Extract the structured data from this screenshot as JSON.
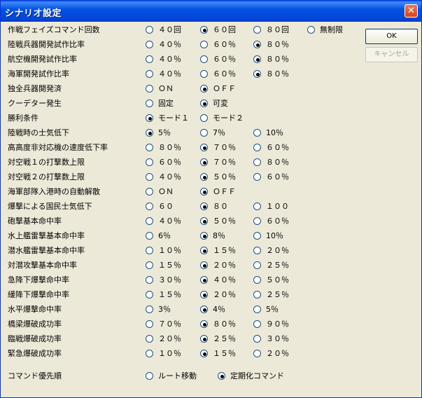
{
  "window": {
    "title": "シナリオ設定"
  },
  "buttons": {
    "ok": "OK",
    "cancel": "キャンセル"
  },
  "rows": [
    {
      "label": "作戦フェイズコマンド回数",
      "options": [
        "４０回",
        "６０回",
        "８０回",
        "無制限"
      ],
      "selected": 1
    },
    {
      "label": "陸戦兵器開発試作比率",
      "options": [
        "４０％",
        "６０％",
        "８０％"
      ],
      "selected": 2
    },
    {
      "label": "航空機開発試作比率",
      "options": [
        "４０％",
        "６０％",
        "８０％"
      ],
      "selected": 2
    },
    {
      "label": "海軍開発試作比率",
      "options": [
        "４０％",
        "６０％",
        "８０％"
      ],
      "selected": 2
    },
    {
      "label": "独全兵器開発済",
      "options": [
        "ＯＮ",
        "ＯＦＦ"
      ],
      "selected": 1
    },
    {
      "label": "クーデター発生",
      "options": [
        "固定",
        "可変"
      ],
      "selected": 1
    },
    {
      "label": "勝利条件",
      "options": [
        "モード１",
        "モード２"
      ],
      "selected": 0
    },
    {
      "label": "陸戦時の士気低下",
      "options": [
        "5％",
        "7％",
        "10％"
      ],
      "selected": 0
    },
    {
      "label": "高高度非対応機の速度低下率",
      "options": [
        "８０％",
        "７０％",
        "６０％"
      ],
      "selected": 1
    },
    {
      "label": "対空戦１の打撃数上限",
      "options": [
        "６０％",
        "７０％",
        "８０％"
      ],
      "selected": 1
    },
    {
      "label": "対空戦２の打撃数上限",
      "options": [
        "４０％",
        "５０％",
        "６０％"
      ],
      "selected": 1
    },
    {
      "label": "海軍部隊入港時の自動解散",
      "options": [
        "ＯＮ",
        "ＯＦＦ"
      ],
      "selected": 1
    },
    {
      "label": "爆撃による国民士気低下",
      "options": [
        "６０",
        "８０",
        "１００"
      ],
      "selected": 1
    },
    {
      "label": "砲撃基本命中率",
      "options": [
        "４０％",
        "５０％",
        "６０％"
      ],
      "selected": 1
    },
    {
      "label": "水上艦雷撃基本命中率",
      "options": [
        "6％",
        "8％",
        "10％"
      ],
      "selected": 1
    },
    {
      "label": "潜水艦雷撃基本命中率",
      "options": [
        "１０％",
        "１５％",
        "２０％"
      ],
      "selected": 1
    },
    {
      "label": "対潜攻撃基本命中率",
      "options": [
        "１５％",
        "２０％",
        "２５％"
      ],
      "selected": 1
    },
    {
      "label": "急降下爆撃命中率",
      "options": [
        "３０％",
        "４０％",
        "５０％"
      ],
      "selected": 1
    },
    {
      "label": "緩降下爆撃命中率",
      "options": [
        "１５％",
        "２０％",
        "２５％"
      ],
      "selected": 1
    },
    {
      "label": "水平爆撃命中率",
      "options": [
        "3％",
        "4％",
        "5％"
      ],
      "selected": 1
    },
    {
      "label": "橋梁爆破成功率",
      "options": [
        "７０％",
        "８０％",
        "９０％"
      ],
      "selected": 1
    },
    {
      "label": "臨戦爆破成功率",
      "options": [
        "２０％",
        "２５％",
        "３０％"
      ],
      "selected": 1
    },
    {
      "label": "緊急爆破成功率",
      "options": [
        "１０％",
        "１５％",
        "２０％"
      ],
      "selected": 1
    }
  ],
  "command_priority": {
    "label": "コマンド優先順",
    "options": [
      "ルート移動",
      "定期化コマンド"
    ],
    "selected": 1
  }
}
